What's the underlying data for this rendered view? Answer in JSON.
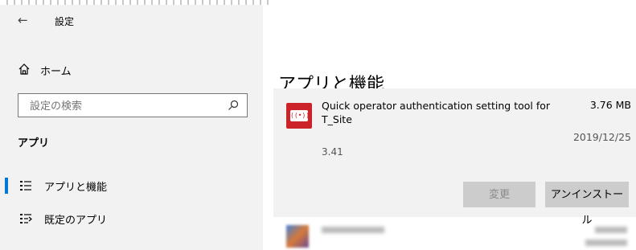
{
  "window": {
    "title": "設定"
  },
  "sidebar": {
    "home_label": "ホーム",
    "search_placeholder": "設定の検索",
    "section_title": "アプリ",
    "items": [
      {
        "label": "アプリと機能",
        "icon": "apps-features-icon",
        "active": true
      },
      {
        "label": "既定のアプリ",
        "icon": "default-apps-icon",
        "active": false
      }
    ]
  },
  "main": {
    "page_title": "アプリと機能",
    "selected_app": {
      "name": "Quick operator authentication setting tool for T_Site",
      "size": "3.76 MB",
      "date": "2019/12/25",
      "version": "3.41",
      "icon_text": "((•))",
      "modify_label": "変更",
      "uninstall_label": "アンインストール"
    }
  },
  "colors": {
    "accent": "#0078d7",
    "app_icon": "#cc2229",
    "panel": "#f2f2f2"
  }
}
